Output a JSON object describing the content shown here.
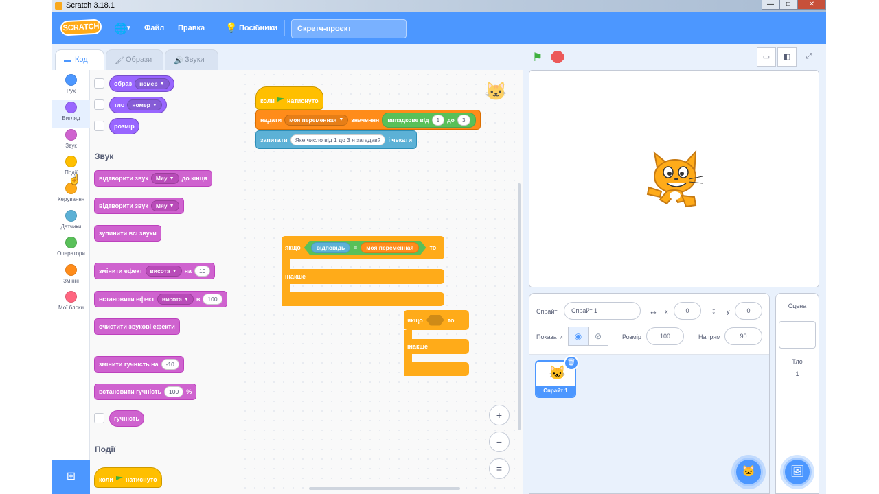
{
  "window": {
    "title": "Scratch 3.18.1",
    "controls": [
      "—",
      "□",
      "✕"
    ]
  },
  "menu": {
    "logo": "SCRATCH",
    "file": "Файл",
    "edit": "Правка",
    "tutorials": "Посібники",
    "project_title": "Скретч-проєкт"
  },
  "tabs": {
    "code": "Код",
    "costumes": "Образи",
    "sounds": "Звуки"
  },
  "categories": [
    {
      "label": "Рух",
      "color": "#4c97ff"
    },
    {
      "label": "Вигляд",
      "color": "#9966ff"
    },
    {
      "label": "Звук",
      "color": "#cf63cf"
    },
    {
      "label": "Події",
      "color": "#ffbf00"
    },
    {
      "label": "Керування",
      "color": "#ffab19"
    },
    {
      "label": "Датчики",
      "color": "#5cb1d6"
    },
    {
      "label": "Оператори",
      "color": "#59c059"
    },
    {
      "label": "Змінні",
      "color": "#ff8c1a"
    },
    {
      "label": "Мої блоки",
      "color": "#ff6680"
    }
  ],
  "palette": {
    "looks": {
      "costume": {
        "label": "образ",
        "option": "номер"
      },
      "backdrop": {
        "label": "тло",
        "option": "номер"
      },
      "size": "розмір"
    },
    "sound_heading": "Звук",
    "sound": {
      "play_until_done": {
        "pre": "відтворити звук",
        "option": "Мяу",
        "post": "до кінця"
      },
      "start_sound": {
        "pre": "відтворити звук",
        "option": "Мяу"
      },
      "stop_all": "зупинити всі звуки",
      "change_effect": {
        "pre": "змінити ефект",
        "option": "висота",
        "mid": "на",
        "value": "10"
      },
      "set_effect": {
        "pre": "встановити ефект",
        "option": "висота",
        "mid": "в",
        "value": "100"
      },
      "clear_effects": "очистити звукові ефекти",
      "change_volume": {
        "pre": "змінити гучність на",
        "value": "-10"
      },
      "set_volume": {
        "pre": "встановити гучність",
        "value": "100",
        "post": "%"
      },
      "volume": "гучність"
    },
    "events_heading": "Події",
    "events": {
      "flag_pre": "коли",
      "flag_post": "натиснуто"
    }
  },
  "script": {
    "hat": {
      "pre": "коли",
      "post": "натиснуто"
    },
    "set_var": {
      "pre": "надати",
      "var": "моя переменная",
      "mid": "значення",
      "random": "випадкове від",
      "from": "1",
      "to_label": "до",
      "to": "3"
    },
    "ask": {
      "pre": "запитати",
      "question": "Яке число  від 1 до 3 я загадав?",
      "post": "і чекати"
    },
    "if1": {
      "if_label": "якщо",
      "answer": "відповідь",
      "eq": "=",
      "var": "моя переменная",
      "then": "то",
      "else": "інакше"
    },
    "if2": {
      "if_label": "якщо",
      "then": "то",
      "else": "інакше"
    }
  },
  "zoom": {
    "in": "+",
    "out": "−",
    "reset": "="
  },
  "sprite_info": {
    "sprite_label": "Спрайт",
    "sprite_name": "Спрайт 1",
    "x_label": "x",
    "x": "0",
    "y_label": "y",
    "y": "0",
    "show_label": "Показати",
    "size_label": "Розмір",
    "size": "100",
    "direction_label": "Напрям",
    "direction": "90"
  },
  "sprites": [
    {
      "name": "Спрайт 1"
    }
  ],
  "stage_panel": {
    "title": "Сцена",
    "backdrops_label": "Тло",
    "backdrops_count": "1"
  },
  "icons": {
    "globe": "globe-icon",
    "tutorials": "lightbulb-icon",
    "flag": "green-flag-icon",
    "stop": "stop-icon",
    "add_sprite": "add-sprite-icon",
    "add_backdrop": "add-backdrop-icon",
    "extensions": "add-extension-icon"
  }
}
